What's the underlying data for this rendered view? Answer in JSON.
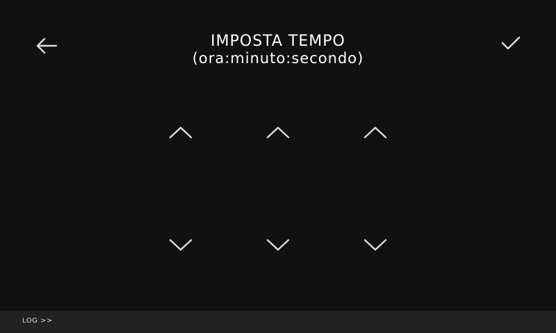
{
  "header": {
    "title": "IMPOSTA TEMPO",
    "subtitle": "(ora:minuto:secondo)",
    "back_icon": "arrow-left-icon",
    "confirm_icon": "checkmark-icon"
  },
  "time_picker": {
    "columns": [
      {
        "unit": "ora",
        "up_icon": "chevron-up-icon",
        "down_icon": "chevron-down-icon"
      },
      {
        "unit": "minuto",
        "up_icon": "chevron-up-icon",
        "down_icon": "chevron-down-icon"
      },
      {
        "unit": "secondo",
        "up_icon": "chevron-up-icon",
        "down_icon": "chevron-down-icon"
      }
    ]
  },
  "footer": {
    "log_label": "LOG >>"
  },
  "colors": {
    "background": "#111111",
    "footer_background": "#222222",
    "icon": "#dddddd",
    "text": "#ffffff"
  }
}
